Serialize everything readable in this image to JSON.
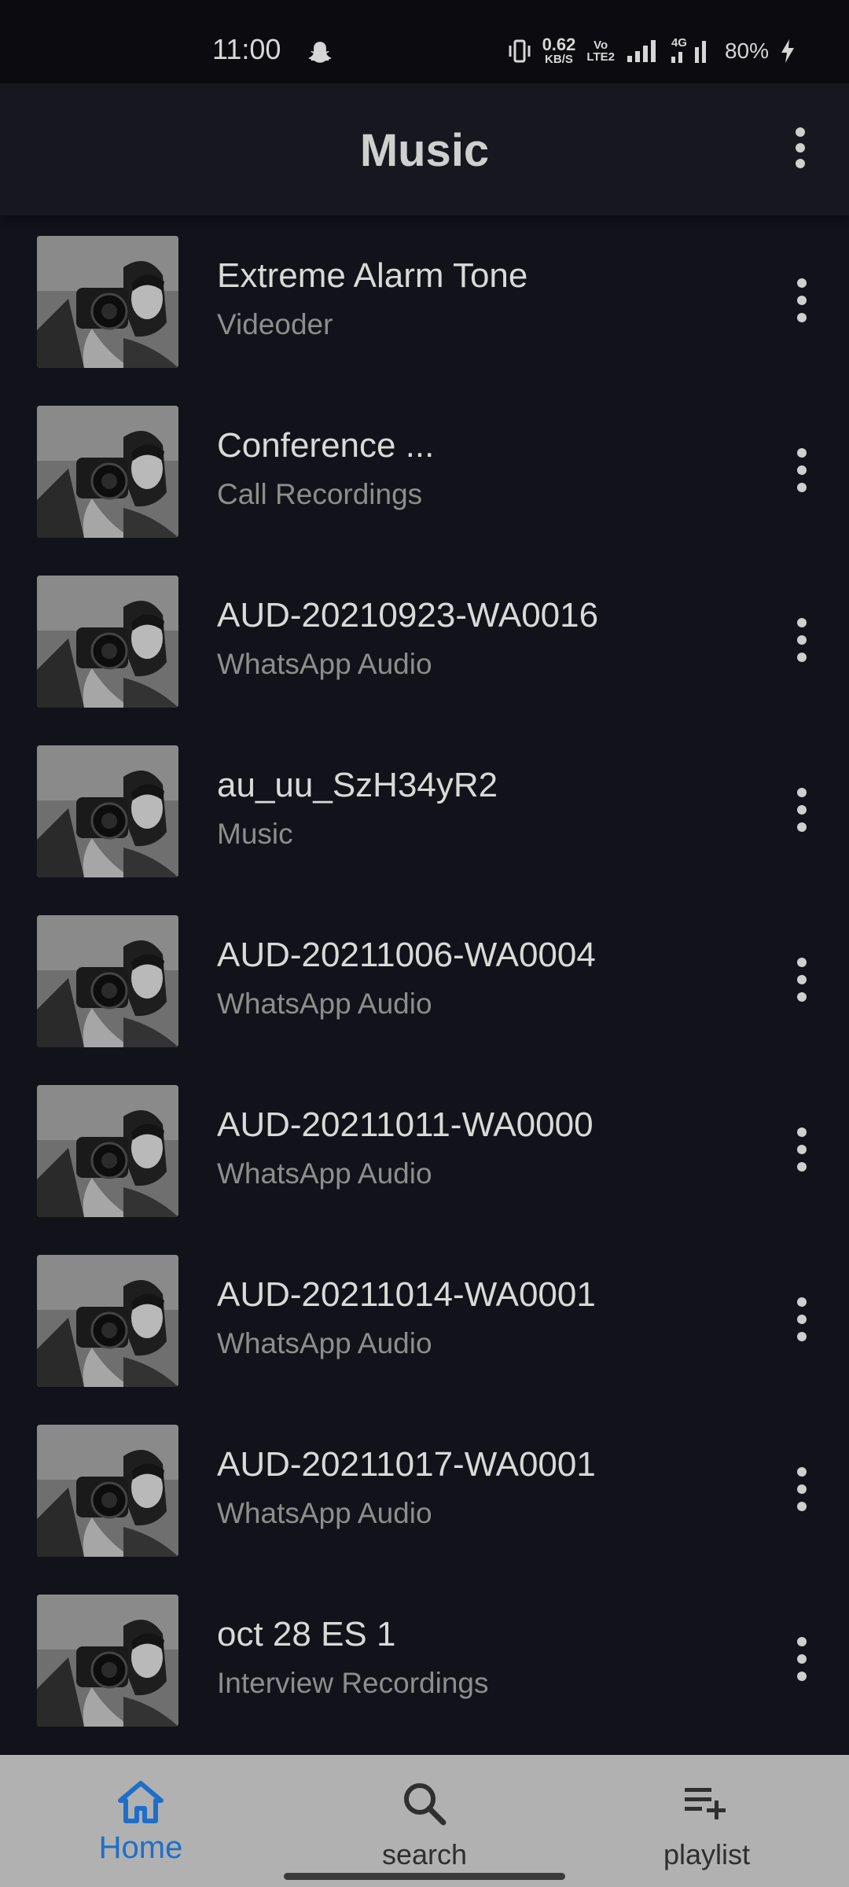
{
  "status_bar": {
    "time": "11:00",
    "net_speed_value": "0.62",
    "net_speed_unit": "KB/S",
    "volte_top": "Vo",
    "volte_bottom": "LTE2",
    "network_label": "4G",
    "battery": "80%"
  },
  "app_bar": {
    "title": "Music"
  },
  "songs": [
    {
      "title": "Extreme Alarm Tone",
      "subtitle": "Videoder"
    },
    {
      "title": "Conference ...",
      "subtitle": "Call Recordings"
    },
    {
      "title": "AUD-20210923-WA0016",
      "subtitle": "WhatsApp Audio"
    },
    {
      "title": "au_uu_SzH34yR2",
      "subtitle": "Music"
    },
    {
      "title": "AUD-20211006-WA0004",
      "subtitle": "WhatsApp Audio"
    },
    {
      "title": "AUD-20211011-WA0000",
      "subtitle": "WhatsApp Audio"
    },
    {
      "title": "AUD-20211014-WA0001",
      "subtitle": "WhatsApp Audio"
    },
    {
      "title": "AUD-20211017-WA0001",
      "subtitle": "WhatsApp Audio"
    },
    {
      "title": "oct 28 ES 1",
      "subtitle": "Interview Recordings"
    }
  ],
  "bottom_nav": {
    "home_label": "Home",
    "search_label": "search",
    "playlist_label": "playlist",
    "active_color": "#1e6fc8",
    "inactive_color": "#2f2f2f"
  },
  "icons": {
    "thumbnail": "album-art-thumbnail",
    "row_menu": "more-vert-icon",
    "top_menu": "more-vert-icon",
    "home": "home-icon",
    "search": "search-icon",
    "playlist": "playlist-add-icon"
  }
}
